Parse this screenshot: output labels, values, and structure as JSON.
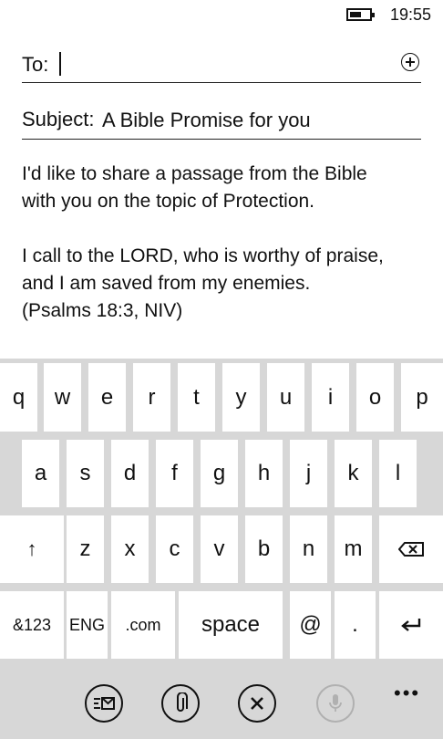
{
  "status_bar": {
    "time": "19:55",
    "battery_icon": "battery-icon"
  },
  "compose": {
    "to_label": "To:",
    "to_value": "",
    "subject_label": "Subject:",
    "subject_value": "A Bible Promise for you",
    "body_lines": [
      "I'd like to share a passage from the Bible",
      "with you on the topic of Protection.",
      "",
      "I call to the LORD, who is worthy of praise,",
      "and I am saved from my enemies.",
      "(Psalms 18:3, NIV)"
    ]
  },
  "keyboard": {
    "row1": [
      "q",
      "w",
      "e",
      "r",
      "t",
      "y",
      "u",
      "i",
      "o",
      "p"
    ],
    "row2": [
      "a",
      "s",
      "d",
      "f",
      "g",
      "h",
      "j",
      "k",
      "l"
    ],
    "row3": [
      "z",
      "x",
      "c",
      "v",
      "b",
      "n",
      "m"
    ],
    "row4": {
      "symbols": "&123",
      "language": "ENG",
      "dotcom": ".com",
      "space": "space",
      "at": "@",
      "period": "."
    }
  },
  "appbar": {
    "buttons": [
      "send-icon",
      "attach-icon",
      "cancel-icon",
      "microphone-icon"
    ],
    "more": "•••"
  }
}
